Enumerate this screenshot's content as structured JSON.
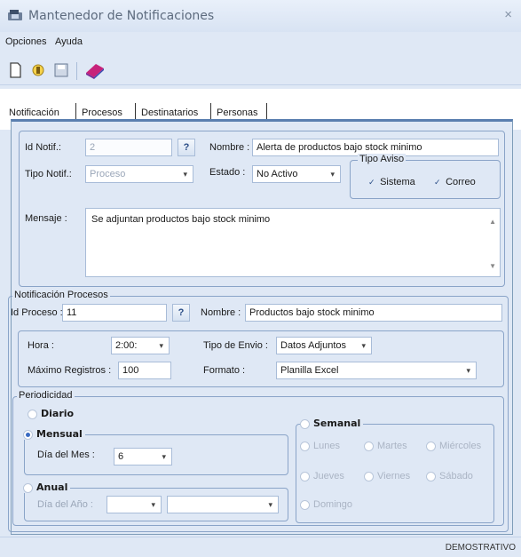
{
  "window": {
    "title": "Mantenedor de Notificaciones",
    "close_glyph": "×"
  },
  "menu": {
    "opciones": "Opciones",
    "ayuda": "Ayuda"
  },
  "toolbar": {
    "icons": [
      "new-icon",
      "edit-icon",
      "save-icon",
      "help-book-icon"
    ]
  },
  "tabs": [
    "Notificación",
    "Procesos",
    "Destinatarios",
    "Personas"
  ],
  "notificacion": {
    "id_label": "Id Notif.:",
    "id_value": "2",
    "lookup_label": "?",
    "nombre_label": "Nombre :",
    "nombre_value": "Alerta de productos bajo stock minimo",
    "tipo_label": "Tipo Notif.:",
    "tipo_value": "Proceso",
    "estado_label": "Estado :",
    "estado_value": "No Activo",
    "tipo_aviso_legend": "Tipo Aviso",
    "sistema_label": "Sistema",
    "correo_label": "Correo",
    "mensaje_label": "Mensaje :",
    "mensaje_value": "Se adjuntan productos bajo stock minimo"
  },
  "procesos": {
    "legend": "Notificación Procesos",
    "id_label": "Id Proceso :",
    "id_value": "11",
    "lookup_label": "?",
    "nombre_label": "Nombre :",
    "nombre_value": "Productos bajo stock minimo",
    "hora_label": "Hora :",
    "hora_value": "2:00:",
    "tipo_envio_label": "Tipo de Envio :",
    "tipo_envio_value": "Datos Adjuntos",
    "maximo_label": "Máximo Registros :",
    "maximo_value": "100",
    "formato_label": "Formato :",
    "formato_value": "Planilla Excel"
  },
  "periodicidad": {
    "legend": "Periodicidad",
    "diario": "Diario",
    "mensual": "Mensual",
    "dia_mes_label": "Día del Mes :",
    "dia_mes_value": "6",
    "anual": "Anual",
    "dia_anio_label": "Día del Año :",
    "semanal": "Semanal",
    "lunes": "Lunes",
    "martes": "Martes",
    "miercoles": "Miércoles",
    "jueves": "Jueves",
    "viernes": "Viernes",
    "sabado": "Sábado",
    "domingo": "Domingo"
  },
  "status": {
    "text": "DEMOSTRATIVO"
  },
  "dropdown_arrow": "▾"
}
